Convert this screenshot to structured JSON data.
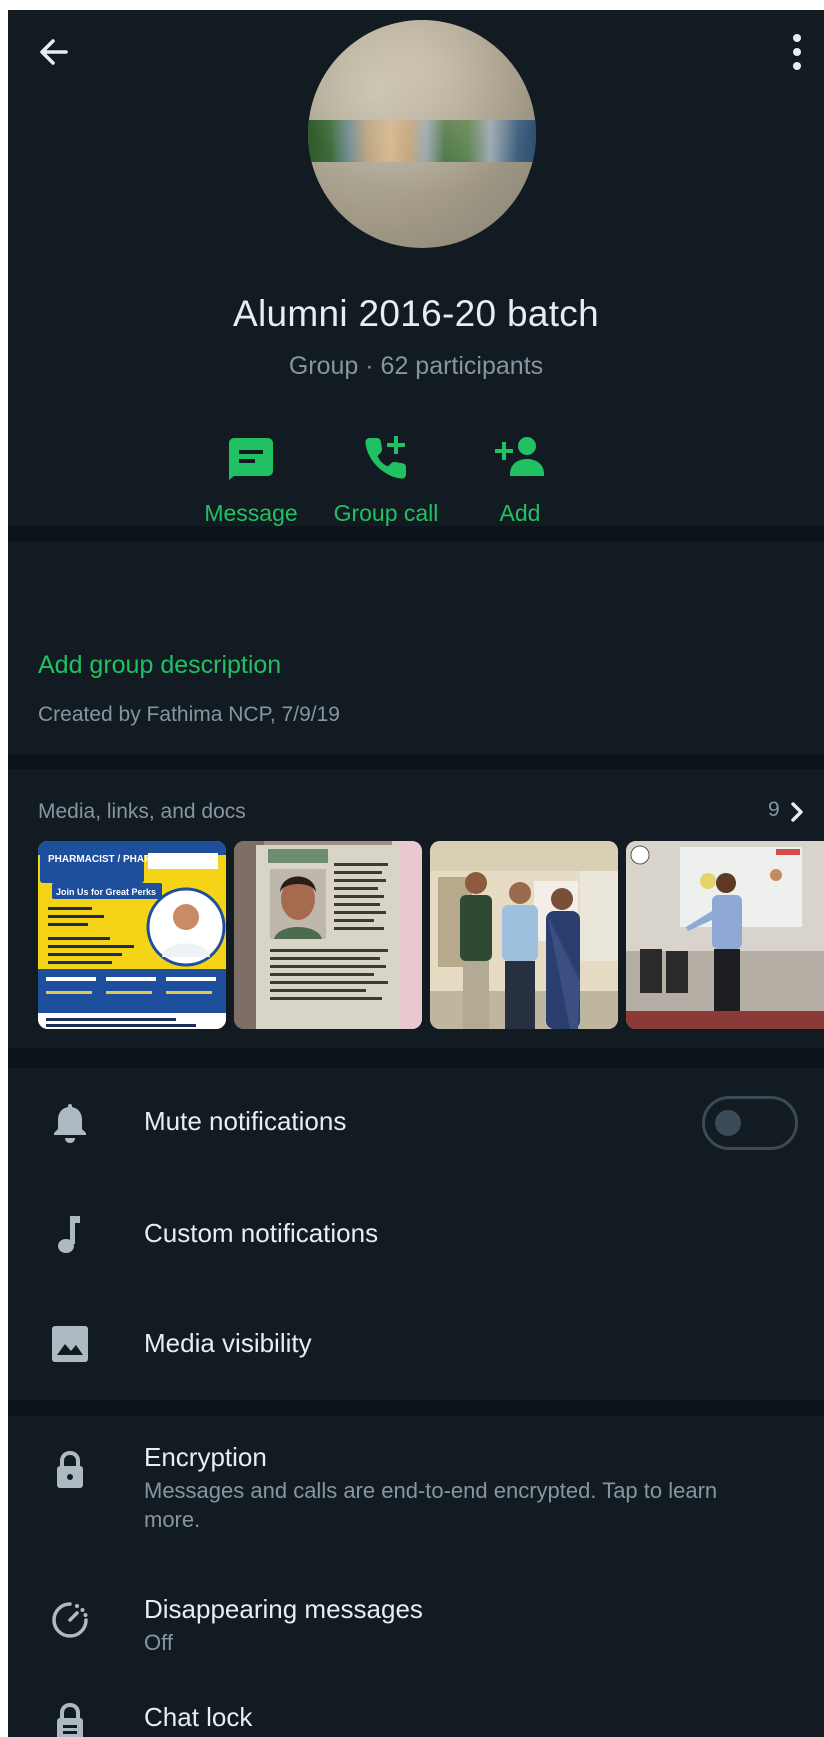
{
  "header": {
    "back_icon": "arrow-left-icon",
    "menu_icon": "more-vertical-icon",
    "group_name": "Alumni 2016-20 batch",
    "group_subtitle": "Group · 62 participants"
  },
  "actions": [
    {
      "label": "Message",
      "icon": "message-icon"
    },
    {
      "label": "Group call",
      "icon": "add-call-icon"
    },
    {
      "label": "Add",
      "icon": "add-person-icon"
    }
  ],
  "description": {
    "add_label": "Add group description",
    "created_by": "Created by Fathima NCP, 7/9/19"
  },
  "media": {
    "title": "Media, links, and docs",
    "count": "9",
    "thumbnails": [
      {
        "alt": "pharmacy job poster",
        "heading": "PHARMACIST / PHARMACY AIDE",
        "subheading": "Join Us for Great Perks"
      },
      {
        "alt": "newspaper clipping with photo"
      },
      {
        "alt": "three people standing photo"
      },
      {
        "alt": "person presenting in classroom"
      }
    ]
  },
  "notifications": {
    "mute_label": "Mute notifications",
    "mute_enabled": false,
    "custom_label": "Custom notifications",
    "media_visibility_label": "Media visibility"
  },
  "privacy": {
    "encryption_title": "Encryption",
    "encryption_desc": "Messages and calls are end-to-end encrypted. Tap to learn more.",
    "disappearing_title": "Disappearing messages",
    "disappearing_value": "Off",
    "chat_lock_title": "Chat lock"
  },
  "colors": {
    "background": "#111b21",
    "separator": "#0b141a",
    "accent": "#21c063",
    "secondary_text": "#8696a0",
    "primary_text": "#e9edef",
    "icon": "#aebac1"
  }
}
